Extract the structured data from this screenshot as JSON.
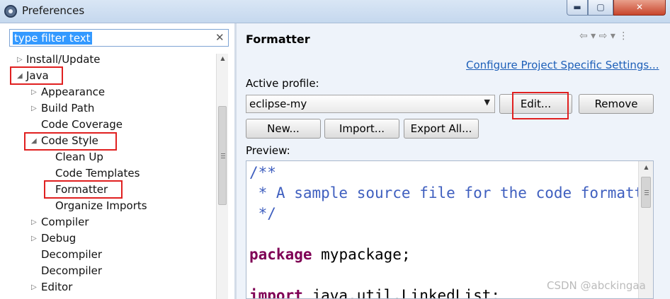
{
  "window": {
    "title": "Preferences",
    "minimize_glyph": "▬",
    "maximize_glyph": "▢",
    "close_glyph": "✕"
  },
  "filter": {
    "text": "type filter text",
    "clear_glyph": "✕"
  },
  "tree": {
    "items": [
      {
        "label": "Install/Update",
        "arrow": "▷"
      },
      {
        "label": "Java",
        "arrow": "◢"
      },
      {
        "label": "Appearance",
        "arrow": "▷"
      },
      {
        "label": "Build Path",
        "arrow": "▷"
      },
      {
        "label": "Code Coverage",
        "arrow": ""
      },
      {
        "label": "Code Style",
        "arrow": "◢"
      },
      {
        "label": "Clean Up",
        "arrow": ""
      },
      {
        "label": "Code Templates",
        "arrow": ""
      },
      {
        "label": "Formatter",
        "arrow": ""
      },
      {
        "label": "Organize Imports",
        "arrow": ""
      },
      {
        "label": "Compiler",
        "arrow": "▷"
      },
      {
        "label": "Debug",
        "arrow": "▷"
      },
      {
        "label": "Decompiler",
        "arrow": ""
      },
      {
        "label": "Decompiler",
        "arrow": ""
      },
      {
        "label": "Editor",
        "arrow": "▷"
      }
    ],
    "highlighted": [
      "Java",
      "Code Style",
      "Formatter"
    ]
  },
  "page": {
    "title": "Formatter",
    "nav_icons": "⇦ ▾ ⇨ ▾ ⋮",
    "project_link": "Configure Project Specific Settings...",
    "profile_label": "Active profile:",
    "profile_value": "eclipse-my",
    "profile_caret": "▼",
    "buttons": {
      "edit": "Edit...",
      "remove": "Remove",
      "new": "New...",
      "import": "Import...",
      "export": "Export All..."
    },
    "preview_label": "Preview:"
  },
  "preview": {
    "lines": [
      {
        "text": "/**",
        "style": "cmt"
      },
      {
        "text": " * A sample source file for the code formatter preview",
        "style": "cmt"
      },
      {
        "text": " */",
        "style": "cmt"
      },
      {
        "text": "",
        "style": ""
      },
      {
        "keyword": "package",
        "rest": " mypackage;"
      },
      {
        "text": "",
        "style": ""
      },
      {
        "keyword": "import",
        "rest": " java.util.LinkedList;"
      }
    ]
  },
  "watermark": "CSDN @abckingaa",
  "colors": {
    "highlight": "#e02020",
    "comment": "#3f5fbf",
    "keyword": "#7f0055",
    "link": "#1d5fb8",
    "selection": "#3399ff"
  }
}
